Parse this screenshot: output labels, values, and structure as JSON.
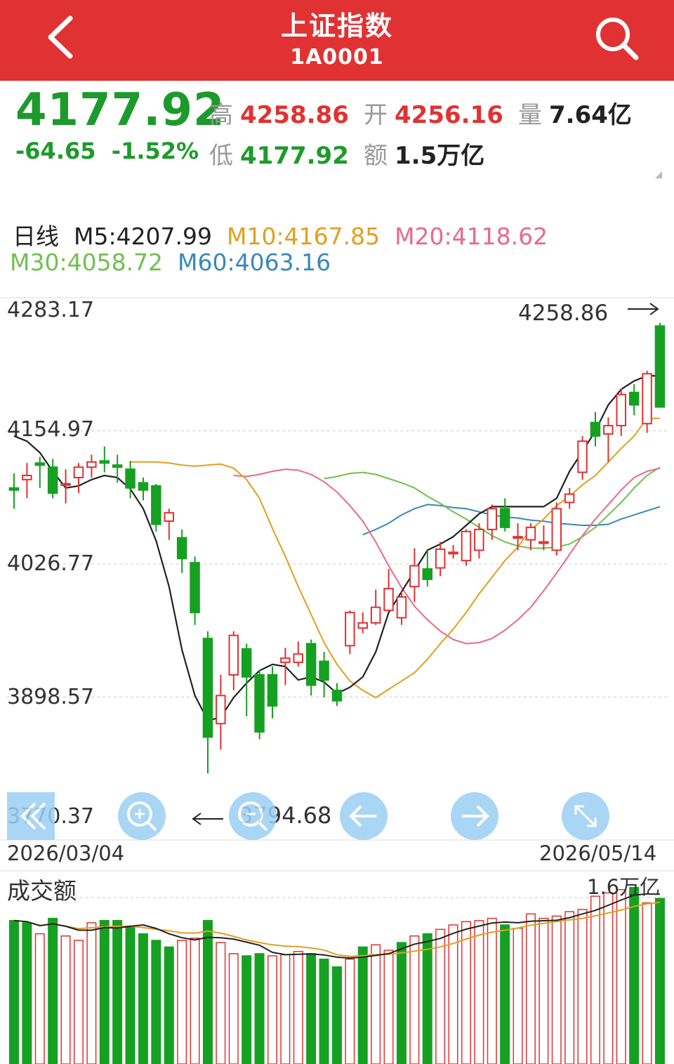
{
  "header": {
    "title": "上证指数",
    "code": "1A0001",
    "back_icon": "chevron-left-icon",
    "search_icon": "search-icon",
    "bg": "#e03232"
  },
  "quote": {
    "price": "4177.92",
    "change": "-64.65",
    "change_pct": "-1.52%",
    "high_label": "高",
    "high": "4258.86",
    "open_label": "开",
    "open": "4256.16",
    "volume_label": "量",
    "volume": "7.64亿",
    "low_label": "低",
    "low": "4177.92",
    "amount_label": "额",
    "amount": "1.5万亿"
  },
  "ma_legend": {
    "period": "日线",
    "m5": "M5:4207.99",
    "m10": "M10:4167.85",
    "m20": "M20:4118.62",
    "m30": "M30:4058.72",
    "m60": "M60:4063.16",
    "colors": {
      "m5": "#222222",
      "m10": "#e0a020",
      "m20": "#e86a8a",
      "m30": "#70c050",
      "m60": "#3a88b8"
    }
  },
  "price_chart": {
    "y_labels": [
      "4283.17",
      "4154.97",
      "4026.77",
      "3898.57",
      "3770.37"
    ],
    "ymax": 4283.17,
    "ymin": 3770.37,
    "high_marker": "4258.86",
    "low_marker": "3794.68",
    "start_date": "2026/03/04",
    "end_date": "2026/05/14",
    "up_color": "#e03232",
    "down_color": "#16a022"
  },
  "chart_data": {
    "type": "candlestick",
    "candles": [
      [
        4100,
        4098,
        4114,
        4080
      ],
      [
        4108,
        4112,
        4124,
        4090
      ],
      [
        4124,
        4122,
        4130,
        4100
      ],
      [
        4120,
        4095,
        4128,
        4090
      ],
      [
        4103,
        4104,
        4118,
        4085
      ],
      [
        4110,
        4120,
        4124,
        4095
      ],
      [
        4120,
        4125,
        4132,
        4110
      ],
      [
        4126,
        4124,
        4140,
        4115
      ],
      [
        4122,
        4120,
        4132,
        4105
      ],
      [
        4118,
        4100,
        4126,
        4090
      ],
      [
        4105,
        4098,
        4110,
        4088
      ],
      [
        4102,
        4065,
        4104,
        4058
      ],
      [
        4068,
        4076,
        4080,
        4050
      ],
      [
        4052,
        4032,
        4060,
        4018
      ],
      [
        4028,
        3980,
        4034,
        3968
      ],
      [
        3955,
        3860,
        3962,
        3825
      ],
      [
        3873,
        3900,
        3920,
        3848
      ],
      [
        3920,
        3958,
        3962,
        3905
      ],
      [
        3945,
        3918,
        3950,
        3880
      ],
      [
        3920,
        3865,
        3925,
        3858
      ],
      [
        3920,
        3890,
        3928,
        3878
      ],
      [
        3932,
        3936,
        3946,
        3910
      ],
      [
        3932,
        3940,
        3952,
        3928
      ],
      [
        3950,
        3910,
        3954,
        3900
      ],
      [
        3933,
        3915,
        3942,
        3898
      ],
      [
        3905,
        3895,
        3912,
        3890
      ],
      [
        3948,
        3980,
        3982,
        3940
      ],
      [
        3965,
        3970,
        3980,
        3960
      ],
      [
        3970,
        3985,
        4002,
        3968
      ],
      [
        3982,
        4003,
        4022,
        3985
      ],
      [
        3975,
        3995,
        4000,
        3968
      ],
      [
        4005,
        4025,
        4042,
        3990
      ],
      [
        4022,
        4012,
        4040,
        4005
      ],
      [
        4023,
        4041,
        4048,
        4015
      ],
      [
        4038,
        4038,
        4045,
        4032
      ],
      [
        4030,
        4058,
        4060,
        4025
      ],
      [
        4040,
        4060,
        4066,
        4032
      ],
      [
        4060,
        4080,
        4084,
        4050
      ],
      [
        4080,
        4062,
        4090,
        4058
      ],
      [
        4052,
        4053,
        4066,
        4040
      ],
      [
        4050,
        4062,
        4066,
        4040
      ],
      [
        4048,
        4048,
        4064,
        4040
      ],
      [
        4040,
        4080,
        4086,
        4035
      ],
      [
        4086,
        4094,
        4100,
        4080
      ],
      [
        4115,
        4145,
        4150,
        4108
      ],
      [
        4163,
        4150,
        4173,
        4140
      ],
      [
        4152,
        4160,
        4168,
        4125
      ],
      [
        4160,
        4190,
        4196,
        4150
      ],
      [
        4192,
        4180,
        4200,
        4170
      ],
      [
        4162,
        4210,
        4213,
        4153
      ],
      [
        4256,
        4178,
        4259,
        4178
      ]
    ],
    "moving_averages": {
      "m5": [
        4150,
        4145,
        4134,
        4116,
        4100,
        4102,
        4108,
        4112,
        4110,
        4099,
        4080,
        4049,
        4005,
        3944,
        3900,
        3876,
        3879,
        3898,
        3912,
        3924,
        3930,
        3928,
        3915,
        3918,
        3913,
        3902,
        3908,
        3918,
        3942,
        3980,
        4000,
        4020,
        4040,
        4046,
        4053,
        4064,
        4075,
        4082,
        4082,
        4082,
        4082,
        4082,
        4090,
        4116,
        4135,
        4155,
        4180,
        4195,
        4203,
        4208,
        4208
      ],
      "m10": [
        4125,
        4125,
        4125,
        4124,
        4122,
        4121,
        4122,
        4123,
        4119,
        4108,
        4090,
        4061,
        4034,
        4005,
        3978,
        3951,
        3930,
        3914,
        3905,
        3898,
        3906,
        3914,
        3922,
        3935,
        3950,
        3964,
        3980,
        3998,
        4014,
        4030,
        4043,
        4060,
        4070,
        4083,
        4092,
        4103,
        4112,
        4125,
        4138,
        4150,
        4167,
        4167
      ],
      "m20": [
        4112,
        4111,
        4113,
        4116,
        4118,
        4117,
        4113,
        4106,
        4096,
        4083,
        4068,
        4048,
        4025,
        4004,
        3986,
        3973,
        3962,
        3954,
        3950,
        3951,
        3955,
        3963,
        3973,
        3985,
        4001,
        4018,
        4036,
        4054,
        4070,
        4084,
        4098,
        4110,
        4116,
        4119
      ],
      "m30": [
        4109,
        4111,
        4114,
        4115,
        4113,
        4109,
        4105,
        4100,
        4092,
        4085,
        4077,
        4070,
        4062,
        4054,
        4048,
        4044,
        4042,
        4042,
        4043,
        4046,
        4053,
        4062,
        4074,
        4086,
        4100,
        4112,
        4120
      ],
      "m60": [
        4055,
        4060,
        4066,
        4074,
        4080,
        4084,
        4083,
        4081,
        4080,
        4077,
        4074,
        4072,
        4071,
        4069,
        4068,
        4066,
        4065,
        4064,
        4064,
        4065,
        4070,
        4074,
        4078,
        4082
      ]
    },
    "ylim": [
      3770.37,
      4283.17
    ]
  },
  "volume_chart": {
    "label": "成交额",
    "max_label": "1.6万亿",
    "bars": [
      1.3,
      1.28,
      1.18,
      1.32,
      1.16,
      1.12,
      1.28,
      1.3,
      1.3,
      1.24,
      1.18,
      1.12,
      1.06,
      1.12,
      1.14,
      1.3,
      1.1,
      1.0,
      0.98,
      1.0,
      0.98,
      0.99,
      1.02,
      1.0,
      0.95,
      0.88,
      0.95,
      1.06,
      1.08,
      1.03,
      1.1,
      1.16,
      1.18,
      1.22,
      1.26,
      1.29,
      1.3,
      1.32,
      1.26,
      1.23,
      1.36,
      1.32,
      1.34,
      1.38,
      1.4,
      1.52,
      1.55,
      1.58,
      1.6,
      1.46,
      1.5
    ],
    "bar_up": [
      0,
      0,
      1,
      0,
      1,
      1,
      1,
      0,
      0,
      0,
      0,
      0,
      0,
      1,
      1,
      0,
      1,
      1,
      0,
      0,
      1,
      1,
      1,
      0,
      0,
      0,
      1,
      0,
      1,
      1,
      0,
      1,
      0,
      1,
      1,
      1,
      1,
      1,
      0,
      1,
      1,
      1,
      1,
      1,
      1,
      1,
      1,
      1,
      0,
      1,
      0
    ]
  },
  "nav_buttons": [
    {
      "icon": "double-chevron-left-icon"
    },
    {
      "icon": "zoom-in-icon"
    },
    {
      "icon": "zoom-out-icon"
    },
    {
      "icon": "arrow-left-icon"
    },
    {
      "icon": "arrow-right-icon"
    },
    {
      "icon": "fullscreen-icon"
    }
  ]
}
